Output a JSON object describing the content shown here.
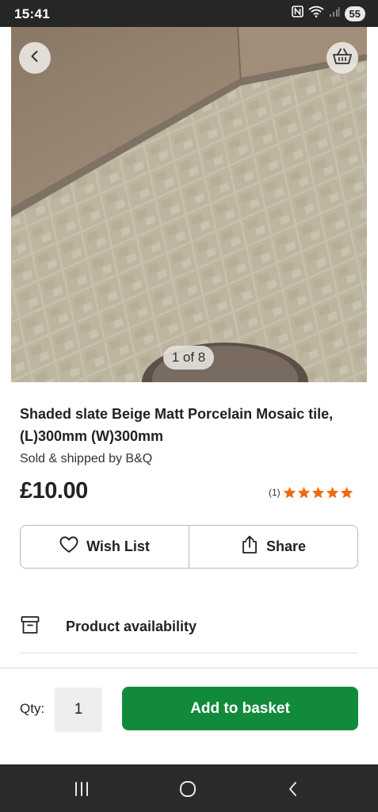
{
  "status_bar": {
    "time": "15:41",
    "battery": "55",
    "icons": [
      "nfc-icon",
      "wifi-icon",
      "signal-icon"
    ]
  },
  "gallery": {
    "counter": "1 of 8",
    "back_icon": "chevron-left-icon",
    "basket_icon": "basket-icon"
  },
  "product": {
    "title": "Shaded slate Beige Matt Porcelain Mosaic tile, (L)300mm (W)300mm",
    "seller": "Sold & shipped by B&Q",
    "price": "£10.00",
    "rating_count": "(1)",
    "rating_stars": 5,
    "star_color": "#f06a0f"
  },
  "actions": {
    "wishlist_label": "Wish List",
    "share_label": "Share"
  },
  "availability": {
    "label": "Product availability"
  },
  "purchase": {
    "qty_label": "Qty:",
    "qty_value": "1",
    "add_label": "Add to basket",
    "accent": "#128a3c"
  }
}
